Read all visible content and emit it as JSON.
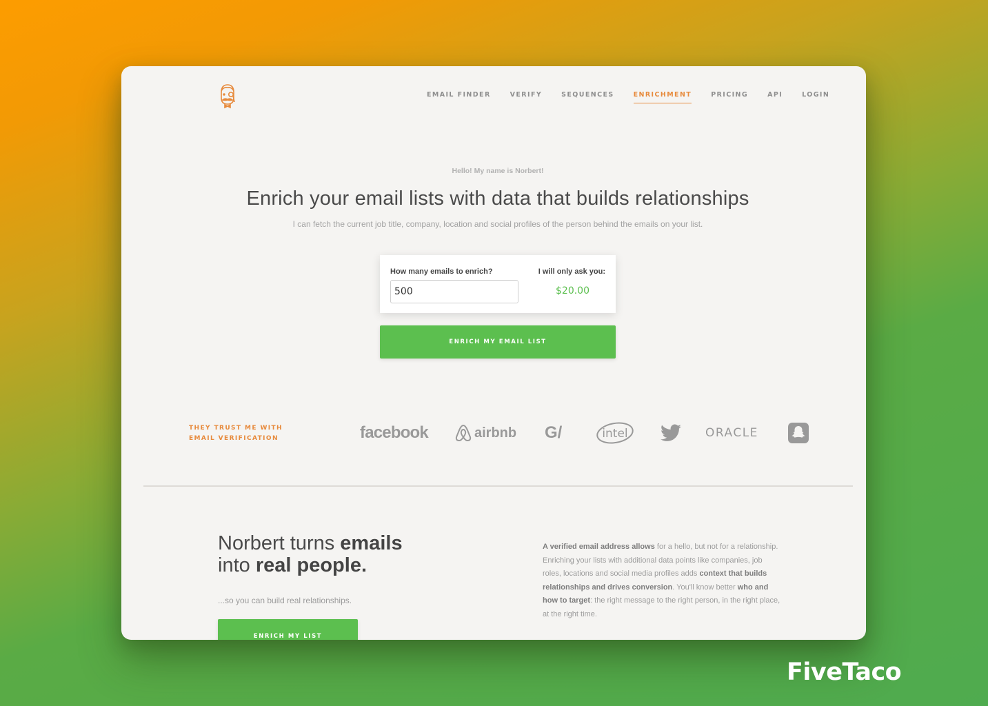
{
  "nav": {
    "items": [
      {
        "label": "EMAIL FINDER",
        "active": false
      },
      {
        "label": "VERIFY",
        "active": false
      },
      {
        "label": "SEQUENCES",
        "active": false
      },
      {
        "label": "ENRICHMENT",
        "active": true
      },
      {
        "label": "PRICING",
        "active": false
      },
      {
        "label": "API",
        "active": false
      },
      {
        "label": "LOGIN",
        "active": false
      }
    ]
  },
  "logo": {
    "icon": "norbert-monocle-face-icon",
    "color": "#e78a3c"
  },
  "hero": {
    "eyebrow": "Hello! My name is Norbert!",
    "title": "Enrich your email lists with data that builds relationships",
    "subtitle": "I can fetch the current job title, company, location and social profiles of the person behind the emails on your list."
  },
  "calculator": {
    "count_label": "How many emails to enrich?",
    "count_value": "500",
    "price_label": "I will only ask you:",
    "price_value": "$20.00",
    "submit_label": "ENRICH MY EMAIL LIST"
  },
  "trust": {
    "line1": "THEY TRUST ME WITH",
    "line2": "EMAIL VERIFICATION",
    "brands": [
      "facebook",
      "airbnb",
      "G/",
      "intel",
      "twitter",
      "ORACLE",
      "snapchat"
    ]
  },
  "feature": {
    "title_part1": "Norbert turns ",
    "title_bold1": "emails",
    "title_part2": "into ",
    "title_bold2": "real people.",
    "tagline": "...so you can build real relationships.",
    "cta_label": "ENRICH MY LIST",
    "paragraph": [
      {
        "text": "A verified email address allows",
        "bold": true
      },
      {
        "text": " for a hello, but not for a relationship. Enriching your lists with additional data points like companies, job roles, locations and social media profiles adds ",
        "bold": false
      },
      {
        "text": "context that builds relationships and drives conversion",
        "bold": true
      },
      {
        "text": ". You'll know better ",
        "bold": false
      },
      {
        "text": "who and how to target",
        "bold": true
      },
      {
        "text": ": the right message to the right person, in the right place, at the right time.",
        "bold": false
      }
    ]
  },
  "watermark": "FiveTaco",
  "colors": {
    "accent_orange": "#e78a3c",
    "accent_green": "#5cbf4f",
    "card_bg": "#f5f4f2"
  }
}
